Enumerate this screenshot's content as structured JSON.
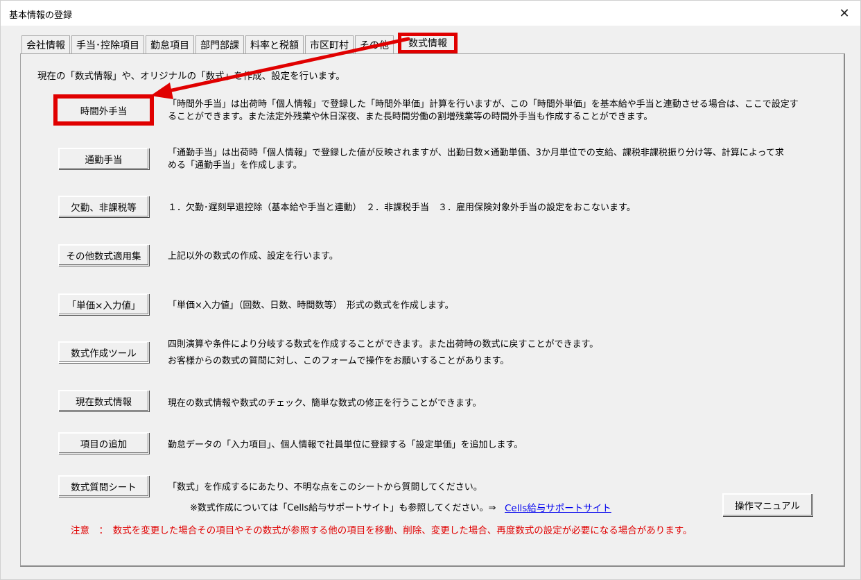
{
  "window": {
    "title": "基本情報の登録",
    "close_glyph": "✕"
  },
  "tabs": [
    {
      "label": "会社情報"
    },
    {
      "label": "手当･控除項目"
    },
    {
      "label": "勤怠項目"
    },
    {
      "label": "部門部課"
    },
    {
      "label": "料率と税額"
    },
    {
      "label": "市区町村"
    },
    {
      "label": "その他"
    },
    {
      "label": "数式情報",
      "active": true
    }
  ],
  "intro": "現在の「数式情報」や、オリジナルの「数式」を作成、設定を行います。",
  "rows": [
    {
      "button": "時間外手当",
      "line1": "「時間外手当」は出荷時「個人情報」で登録した「時間外単価」計算を行いますが、この「時間外単価」を基本給や手当と連動させる場合は、ここで設定す",
      "line2": "ることができます。また法定外残業や休日深夜、また長時間労働の割増残業等の時間外手当も作成することができます。"
    },
    {
      "button": "通勤手当",
      "line1": "「通勤手当」は出荷時「個人情報」で登録した値が反映されますが、出勤日数×通勤単価、3か月単位での支給、課税非課税振り分け等、計算によって求",
      "line2": "める「通勤手当」を作成します。"
    },
    {
      "button": "欠勤、非課税等",
      "line1": "１．欠勤･遅刻早退控除（基本給や手当と連動）　２．非課税手当　３．雇用保険対象外手当の設定をおこないます。",
      "line2": ""
    },
    {
      "button": "その他数式適用集",
      "line1": "上記以外の数式の作成、設定を行います。",
      "line2": ""
    },
    {
      "button": "「単価×入力値」",
      "line1": "「単価×入力値」（回数、日数、時間数等）　形式の数式を作成します。",
      "line2": ""
    },
    {
      "button": "数式作成ツール",
      "line1": "四則演算や条件により分岐する数式を作成することができます。また出荷時の数式に戻すことができます。",
      "line2": "お客様からの数式の質問に対し、このフォームで操作をお願いすることがあります。"
    },
    {
      "button": "現在数式情報",
      "line1": "現在の数式情報や数式のチェック、簡単な数式の修正を行うことができます。",
      "line2": ""
    },
    {
      "button": "項目の追加",
      "line1": "勤怠データの「入力項目」、個人情報で社員単位に登録する「設定単価」を追加します。",
      "line2": ""
    },
    {
      "button": "数式質問シート",
      "line1": "「数式」を作成するにあたり、不明な点をこのシートから質問してください。",
      "line2": ""
    }
  ],
  "reference": {
    "note": "※数式作成については「Cells給与サポートサイト」も参照してください。⇒",
    "link": "Cells給与サポートサイト"
  },
  "manual_button": "操作マニュアル",
  "warning": "注意　：　数式を変更した場合その項目やその数式が参照する他の項目を移動、削除、変更した場合、再度数式の設定が必要になる場合があります。",
  "colors": {
    "highlight": "#e00000",
    "link": "#0000ee"
  }
}
